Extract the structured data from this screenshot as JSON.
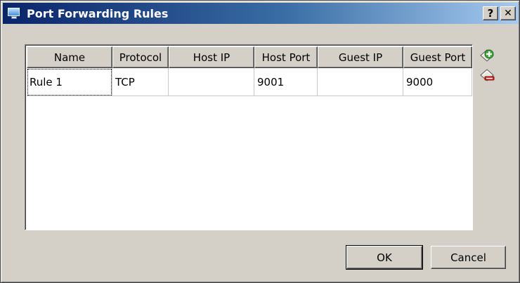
{
  "window": {
    "title": "Port Forwarding Rules",
    "icon": "monitor-icon",
    "help_label": "?",
    "close_label": "✕"
  },
  "table": {
    "columns": [
      "Name",
      "Protocol",
      "Host IP",
      "Host Port",
      "Guest IP",
      "Guest Port"
    ],
    "rows": [
      {
        "name": "Rule 1",
        "protocol": "TCP",
        "host_ip": "",
        "host_port": "9001",
        "guest_ip": "",
        "guest_port": "9000"
      }
    ]
  },
  "side_actions": {
    "add_icon": "add-rule-icon",
    "remove_icon": "remove-rule-icon"
  },
  "buttons": {
    "ok_label": "OK",
    "cancel_label": "Cancel"
  },
  "colors": {
    "titlebar_start": "#0a246a",
    "titlebar_end": "#a6caf0",
    "dialog_bg": "#d4d0c8",
    "add_green": "#3aa83a",
    "remove_red": "#d02020"
  }
}
